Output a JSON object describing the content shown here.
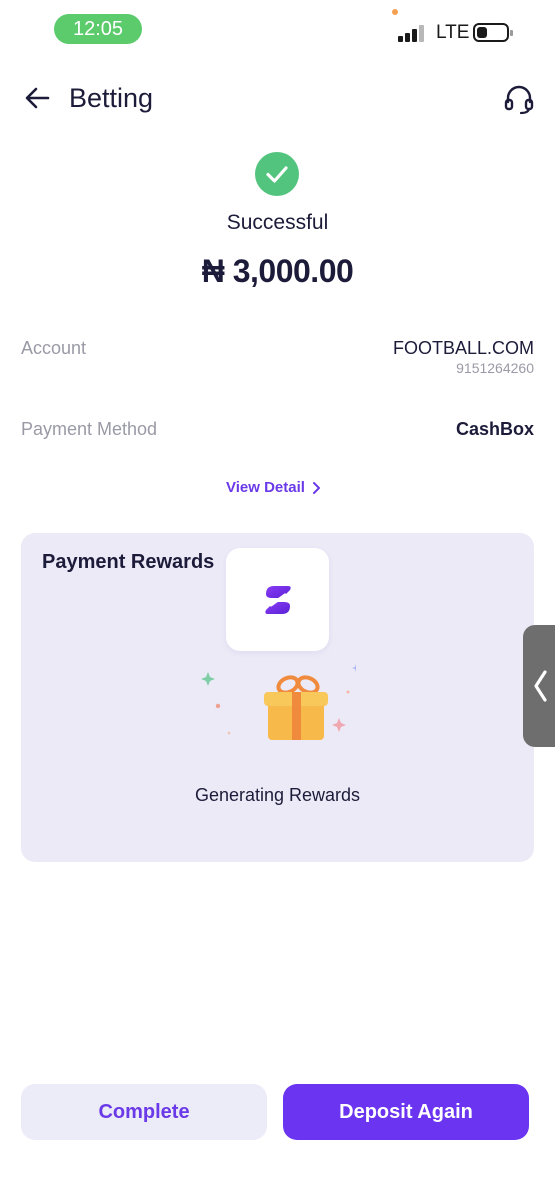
{
  "status_bar": {
    "time": "12:05",
    "network": "LTE",
    "battery_percent": 35
  },
  "header": {
    "title": "Betting",
    "back_icon": "arrow-left-icon",
    "support_icon": "headset-icon"
  },
  "result": {
    "status": "Successful",
    "amount": "₦ 3,000.00"
  },
  "details": {
    "account_label": "Account",
    "account_name": "FOOTBALL.COM",
    "account_number": "9151264260",
    "payment_method_label": "Payment Method",
    "payment_method_value": "CashBox"
  },
  "view_detail_label": "View Detail",
  "rewards": {
    "title": "Payment Rewards",
    "status_text": "Generating Rewards"
  },
  "buttons": {
    "complete": "Complete",
    "deposit_again": "Deposit Again"
  },
  "colors": {
    "accent": "#6b34f0",
    "success": "#52c47e",
    "card_bg": "#eceaf7"
  }
}
